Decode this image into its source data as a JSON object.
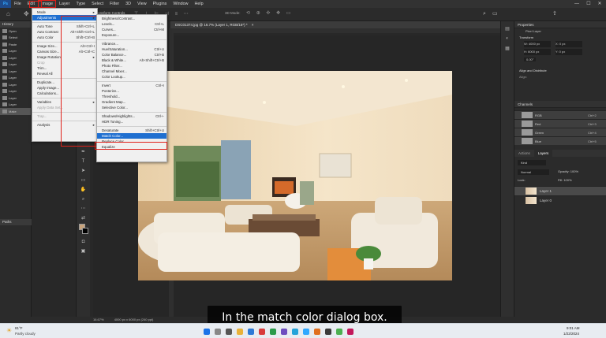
{
  "menubar": {
    "items": [
      "File",
      "Edit",
      "Image",
      "Layer",
      "Type",
      "Select",
      "Filter",
      "3D",
      "View",
      "Plugins",
      "Window",
      "Help"
    ]
  },
  "options": {
    "transform_label": "Transform Controls",
    "mode_label": "3D Mode:"
  },
  "document_tab": "DSC01374.jpg @ 16.7% (Layer 1, RGB/16*) *",
  "history_panel": {
    "title": "History",
    "items": [
      "Open",
      "Select",
      "Paste",
      "Layer",
      "Layer",
      "Layer",
      "Layer",
      "Layer",
      "Layer",
      "Layer",
      "Layer",
      "Layer",
      "Make"
    ]
  },
  "paths_panel": {
    "title": "Paths"
  },
  "image_menu": {
    "items": [
      {
        "label": "Mode",
        "sc": "▸",
        "type": "item"
      },
      {
        "label": "Adjustments",
        "sc": "▸",
        "type": "hl"
      },
      {
        "type": "sep"
      },
      {
        "label": "Auto Tone",
        "sc": "Shift+Ctrl+L",
        "type": "item"
      },
      {
        "label": "Auto Contrast",
        "sc": "Alt+Shift+Ctrl+L",
        "type": "item"
      },
      {
        "label": "Auto Color",
        "sc": "Shift+Ctrl+B",
        "type": "item"
      },
      {
        "type": "sep"
      },
      {
        "label": "Image Size...",
        "sc": "Alt+Ctrl+I",
        "type": "item"
      },
      {
        "label": "Canvas Size...",
        "sc": "Alt+Ctrl+C",
        "type": "item"
      },
      {
        "label": "Image Rotation",
        "sc": "▸",
        "type": "item"
      },
      {
        "label": "Crop",
        "sc": "",
        "type": "dis"
      },
      {
        "label": "Trim...",
        "sc": "",
        "type": "item"
      },
      {
        "label": "Reveal All",
        "sc": "",
        "type": "item"
      },
      {
        "type": "sep"
      },
      {
        "label": "Duplicate...",
        "sc": "",
        "type": "item"
      },
      {
        "label": "Apply Image...",
        "sc": "",
        "type": "item"
      },
      {
        "label": "Calculations...",
        "sc": "",
        "type": "item"
      },
      {
        "type": "sep"
      },
      {
        "label": "Variables",
        "sc": "▸",
        "type": "item"
      },
      {
        "label": "Apply Data Set...",
        "sc": "",
        "type": "dis"
      },
      {
        "type": "sep"
      },
      {
        "label": "Trap...",
        "sc": "",
        "type": "dis"
      },
      {
        "type": "sep"
      },
      {
        "label": "Analysis",
        "sc": "▸",
        "type": "item"
      }
    ]
  },
  "adjustments_menu": {
    "items": [
      {
        "label": "Brightness/Contrast...",
        "sc": "",
        "type": "item"
      },
      {
        "label": "Levels...",
        "sc": "Ctrl+L",
        "type": "item"
      },
      {
        "label": "Curves...",
        "sc": "Ctrl+M",
        "type": "item"
      },
      {
        "label": "Exposure...",
        "sc": "",
        "type": "item"
      },
      {
        "type": "sep"
      },
      {
        "label": "Vibrance...",
        "sc": "",
        "type": "item"
      },
      {
        "label": "Hue/Saturation...",
        "sc": "Ctrl+U",
        "type": "item"
      },
      {
        "label": "Color Balance...",
        "sc": "Ctrl+B",
        "type": "item"
      },
      {
        "label": "Black & White...",
        "sc": "Alt+Shift+Ctrl+B",
        "type": "item"
      },
      {
        "label": "Photo Filter...",
        "sc": "",
        "type": "item"
      },
      {
        "label": "Channel Mixer...",
        "sc": "",
        "type": "item"
      },
      {
        "label": "Color Lookup...",
        "sc": "",
        "type": "item"
      },
      {
        "type": "sep"
      },
      {
        "label": "Invert",
        "sc": "Ctrl+I",
        "type": "item"
      },
      {
        "label": "Posterize...",
        "sc": "",
        "type": "item"
      },
      {
        "label": "Threshold...",
        "sc": "",
        "type": "item"
      },
      {
        "label": "Gradient Map...",
        "sc": "",
        "type": "item"
      },
      {
        "label": "Selective Color...",
        "sc": "",
        "type": "item"
      },
      {
        "type": "sep"
      },
      {
        "label": "Shadows/Highlights...",
        "sc": "Ctrl+-",
        "type": "item"
      },
      {
        "label": "HDR Toning...",
        "sc": "",
        "type": "item"
      },
      {
        "type": "sep"
      },
      {
        "label": "Desaturate",
        "sc": "Shift+Ctrl+U",
        "type": "item"
      },
      {
        "label": "Match Color...",
        "sc": "",
        "type": "hl"
      },
      {
        "label": "Replace Color...",
        "sc": "",
        "type": "item"
      },
      {
        "label": "Equalize",
        "sc": "",
        "type": "item"
      }
    ]
  },
  "properties": {
    "title": "Properties",
    "layer_label": "Pixel Layer",
    "transform_title": "Transform",
    "w": "W: 4000 px",
    "h": "H: 6000 px",
    "x": "X: 0 px",
    "y": "Y: 0 px",
    "angle": "0.00°",
    "align_title": "Align and Distribute",
    "align_sub": "Align:"
  },
  "channels": {
    "title": "Channels",
    "rows": [
      {
        "name": "RGB",
        "sc": "Ctrl+2"
      },
      {
        "name": "Red",
        "sc": "Ctrl+3"
      },
      {
        "name": "Green",
        "sc": "Ctrl+4"
      },
      {
        "name": "Blue",
        "sc": "Ctrl+5"
      }
    ]
  },
  "layers": {
    "tabs": [
      "Actions",
      "Layers"
    ],
    "kind": "Kind",
    "blend": "Normal",
    "opacity": "Opacity: 100%",
    "lock": "Lock:",
    "fill": "Fill: 100%",
    "rows": [
      {
        "name": "Layer 1",
        "selected": true
      },
      {
        "name": "Layer 0",
        "selected": false
      }
    ]
  },
  "status": {
    "zoom": "16.67%",
    "size": "4000 px x 6000 px (240 ppi)"
  },
  "caption": "In the match color dialog box.",
  "taskbar": {
    "temp": "81°F",
    "weather": "Partly cloudy",
    "time": "9:01 AM",
    "date": "1/22/2024"
  }
}
